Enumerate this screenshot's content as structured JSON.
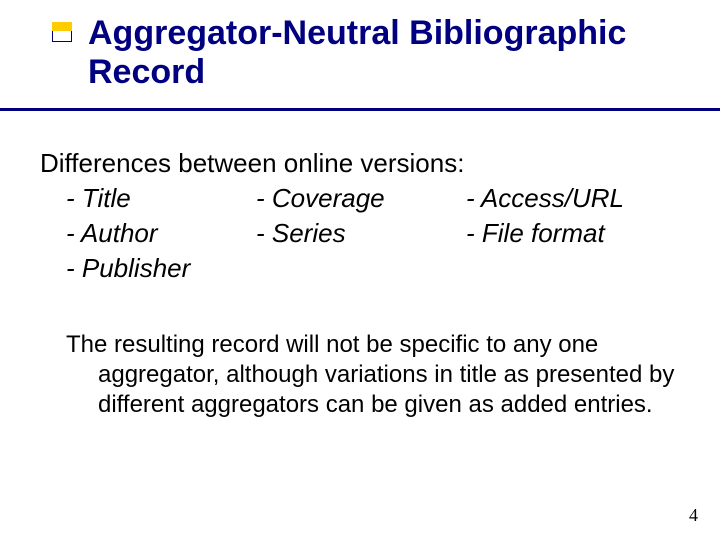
{
  "title": "Aggregator-Neutral Bibliographic Record",
  "intro": "Differences between online versions:",
  "items": {
    "r1c1": "- Title",
    "r1c2": "- Coverage",
    "r1c3": "- Access/URL",
    "r2c1": "- Author",
    "r2c2": "- Series",
    "r2c3": "- File format",
    "r3c1": "- Publisher",
    "r3c2": "",
    "r3c3": ""
  },
  "paragraph": "The resulting record will not be specific to any one aggregator, although variations in title as presented by different aggregators can be given as added entries.",
  "page_number": "4",
  "colors": {
    "accent": "#000080"
  }
}
